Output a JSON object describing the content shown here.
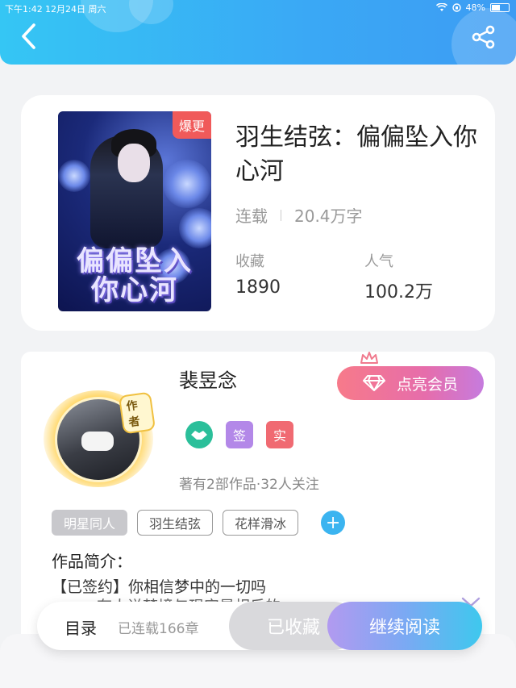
{
  "status_bar": {
    "time": "下午1:42",
    "date": "12月24日 周六",
    "battery": "48%"
  },
  "header": {
    "back_icon": "chevron-left-icon",
    "share_icon": "share-icon"
  },
  "book": {
    "cover_badge": "爆更",
    "cover_title": "偏偏坠入你心河",
    "title": "羽生结弦：偏偏坠入你心河",
    "status": "连载",
    "word_count": "20.4万字",
    "favorites_label": "收藏",
    "favorites_value": "1890",
    "popularity_label": "人气",
    "popularity_value": "100.2万"
  },
  "author": {
    "name": "裴昱念",
    "avatar_tag": "作者",
    "vip_button": "点亮会员",
    "badge_sign": "签",
    "badge_real": "实",
    "works_info": "著有2部作品·32人关注"
  },
  "tags": [
    "明星同人",
    "羽生结弦",
    "花样滑冰"
  ],
  "tag_add": "+",
  "intro": {
    "title": "作品简介：",
    "line1": "【已签约】你相信梦中的一切吗",
    "line2": "……有人说梦境与现实是相反的"
  },
  "bottom_bar": {
    "toc": "目录",
    "chapters": "已连载166章",
    "favorited": "已收藏",
    "continue_reading": "继续阅读"
  },
  "colors": {
    "header_start": "#35c6f4",
    "header_end": "#3d9cf3",
    "vip_start": "#f77a8a",
    "vip_end": "#c67bde",
    "read_start": "#b29af0",
    "read_end": "#3ec8ee",
    "badge_hot": "#f05a5a",
    "badge_sign": "#b388e8",
    "badge_real": "#f06a72",
    "tag_add": "#3bb4f0"
  }
}
